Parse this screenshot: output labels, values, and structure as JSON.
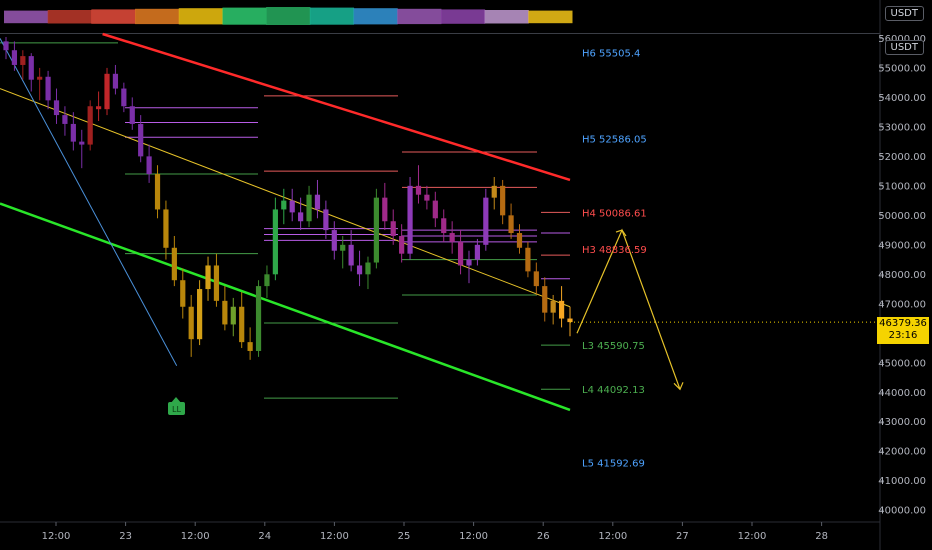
{
  "toolbar": {
    "currency_top": "USDT",
    "currency_second": "USDT"
  },
  "last_price": {
    "value": "46379.36",
    "countdown": "23:16"
  },
  "signal_badge": "LL",
  "chart_data": {
    "type": "candlestick",
    "y_axis_ticks": [
      "56000.00",
      "55000.00",
      "54000.00",
      "53000.00",
      "52000.00",
      "51000.00",
      "50000.00",
      "49000.00",
      "48000.00",
      "47000.00",
      "46000.00",
      "45000.00",
      "44000.00",
      "43000.00",
      "42000.00",
      "41000.00",
      "40000.00"
    ],
    "ylim": [
      39600,
      56150
    ],
    "x_axis_ticks": [
      "12:00",
      "23",
      "12:00",
      "24",
      "12:00",
      "25",
      "12:00",
      "26",
      "12:00",
      "27",
      "12:00",
      "28"
    ],
    "pivot_labels": [
      {
        "label": "H6 55505.4",
        "value": 55505.4,
        "color": "#4ea3ff"
      },
      {
        "label": "H5 52586.05",
        "value": 52586.05,
        "color": "#4ea3ff"
      },
      {
        "label": "H4 50086.61",
        "value": 50086.61,
        "color": "#ff4d4d"
      },
      {
        "label": "H3 48836.59",
        "value": 48836.59,
        "color": "#ff4d4d"
      },
      {
        "label": "L3 45590.75",
        "value": 45590.75,
        "color": "#4caf50"
      },
      {
        "label": "L4 44092.13",
        "value": 44092.13,
        "color": "#4caf50"
      },
      {
        "label": "L5 41592.69",
        "value": 41592.69,
        "color": "#4ea3ff"
      }
    ],
    "candles": [
      [
        55900,
        56050,
        55300,
        55600
      ],
      [
        55600,
        55900,
        54900,
        55100
      ],
      [
        55100,
        55600,
        54600,
        55400
      ],
      [
        55400,
        55500,
        54200,
        54600
      ],
      [
        54600,
        55000,
        53900,
        54700
      ],
      [
        54700,
        54900,
        53600,
        53900
      ],
      [
        53900,
        54300,
        53100,
        53400
      ],
      [
        53400,
        53700,
        52700,
        53100
      ],
      [
        53100,
        53500,
        52200,
        52500
      ],
      [
        52500,
        52900,
        51600,
        52400
      ],
      [
        52400,
        53900,
        52200,
        53700
      ],
      [
        53700,
        54200,
        53200,
        53600
      ],
      [
        53600,
        55000,
        53400,
        54800
      ],
      [
        54800,
        55100,
        54100,
        54300
      ],
      [
        54300,
        54500,
        53500,
        53700
      ],
      [
        53700,
        54000,
        52900,
        53100
      ],
      [
        53100,
        53400,
        51800,
        52000
      ],
      [
        52000,
        52400,
        51100,
        51400
      ],
      [
        51400,
        51700,
        49900,
        50200
      ],
      [
        50200,
        50500,
        48500,
        48900
      ],
      [
        48900,
        49300,
        47600,
        47800
      ],
      [
        47800,
        48200,
        46500,
        46900
      ],
      [
        46900,
        47300,
        45200,
        45800
      ],
      [
        45800,
        47800,
        45600,
        47500
      ],
      [
        47500,
        48600,
        47100,
        48300
      ],
      [
        48300,
        48700,
        46900,
        47100
      ],
      [
        47100,
        47600,
        46100,
        46300
      ],
      [
        46300,
        47200,
        45900,
        46900
      ],
      [
        46900,
        47400,
        45500,
        45700
      ],
      [
        45700,
        46200,
        45100,
        45400
      ],
      [
        45400,
        47800,
        45200,
        47600
      ],
      [
        47600,
        48300,
        47200,
        48000
      ],
      [
        48000,
        50600,
        47800,
        50200
      ],
      [
        50200,
        50900,
        49700,
        50500
      ],
      [
        50500,
        50900,
        49800,
        50100
      ],
      [
        50100,
        50600,
        49500,
        49800
      ],
      [
        49800,
        51000,
        49600,
        50700
      ],
      [
        50700,
        51200,
        49900,
        50200
      ],
      [
        50200,
        50500,
        49200,
        49500
      ],
      [
        49500,
        49800,
        48500,
        48800
      ],
      [
        48800,
        49300,
        48200,
        49000
      ],
      [
        49000,
        49500,
        48100,
        48300
      ],
      [
        48300,
        48800,
        47600,
        48000
      ],
      [
        48000,
        48600,
        47500,
        48400
      ],
      [
        48400,
        50900,
        48200,
        50600
      ],
      [
        50600,
        51100,
        49500,
        49800
      ],
      [
        49800,
        50200,
        49000,
        49300
      ],
      [
        49300,
        49700,
        48400,
        48700
      ],
      [
        48700,
        51300,
        48500,
        51000
      ],
      [
        51000,
        51700,
        50400,
        50700
      ],
      [
        50700,
        51000,
        50200,
        50500
      ],
      [
        50500,
        50800,
        49600,
        49900
      ],
      [
        49900,
        50200,
        49100,
        49400
      ],
      [
        49400,
        49800,
        48700,
        49100
      ],
      [
        49100,
        49500,
        48000,
        48300
      ],
      [
        48300,
        48800,
        47700,
        48500
      ],
      [
        48500,
        49200,
        48300,
        49000
      ],
      [
        49000,
        50900,
        48800,
        50600
      ],
      [
        50600,
        51300,
        50200,
        51000
      ],
      [
        51000,
        51200,
        49700,
        50000
      ],
      [
        50000,
        50400,
        49200,
        49400
      ],
      [
        49400,
        49700,
        48700,
        48900
      ],
      [
        48900,
        49100,
        47900,
        48100
      ],
      [
        48100,
        48400,
        47300,
        47600
      ],
      [
        47600,
        47900,
        46400,
        46700
      ],
      [
        46700,
        47300,
        46300,
        47100
      ],
      [
        47100,
        47600,
        46200,
        46500
      ],
      [
        46500,
        46900,
        45900,
        46379.36
      ]
    ],
    "trend_lines": [
      {
        "color": "#ff2a2a",
        "from": [
          0.18,
          56150
        ],
        "to": [
          1,
          51200
        ]
      },
      {
        "color": "#e6c229",
        "from": [
          0,
          54300
        ],
        "to": [
          1,
          46900
        ]
      },
      {
        "color": "#29e629",
        "from": [
          0,
          50400
        ],
        "to": [
          1,
          43400
        ]
      },
      {
        "color": "#4a90d9",
        "from": [
          0,
          56000
        ],
        "to": [
          0.31,
          44900
        ]
      }
    ],
    "projection": [
      [
        46000,
        0
      ],
      [
        49500,
        1
      ],
      [
        44100,
        2
      ]
    ]
  }
}
